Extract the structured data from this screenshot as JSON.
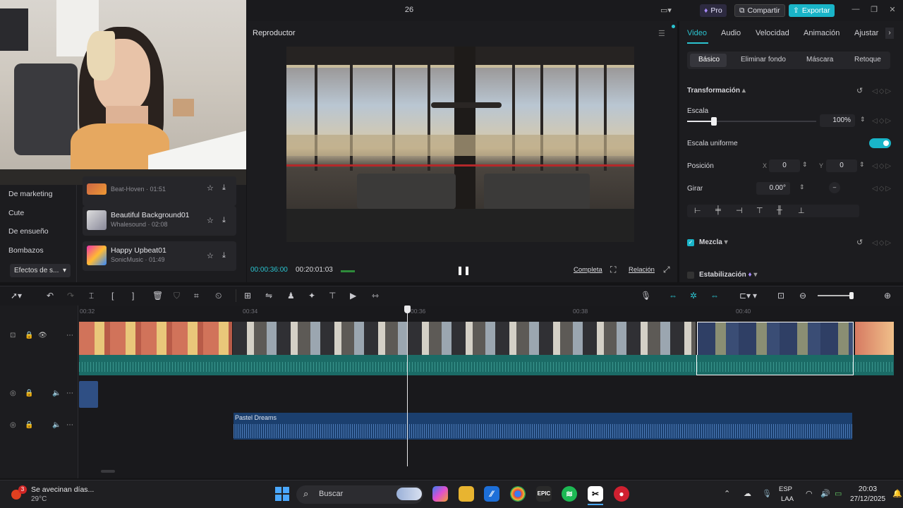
{
  "window": {
    "project_title": "26"
  },
  "header": {
    "pro_label": "Pro",
    "share_label": "Compartir",
    "export_label": "Exportar"
  },
  "sidebar": {
    "categories": [
      "De marketing",
      "Cute",
      "De ensueño",
      "Bombazos"
    ],
    "selected_dropdown": "Efectos de s..."
  },
  "music_list": [
    {
      "name": "",
      "meta": "Beat-Hoven · 01:51"
    },
    {
      "name": "Beautiful Background01",
      "meta": "Whalesound · 02:08"
    },
    {
      "name": "Happy Upbeat01",
      "meta": "SonicMusic · 01:49"
    }
  ],
  "player": {
    "label": "Reproductor",
    "time_current": "00:00:36:00",
    "time_total": "00:20:01:03",
    "full_label": "Completa",
    "ratio_label": "Relación"
  },
  "properties": {
    "tabs": [
      "Video",
      "Audio",
      "Velocidad",
      "Animación",
      "Ajustar"
    ],
    "sub_tabs": [
      "Básico",
      "Eliminar fondo",
      "Máscara",
      "Retoque"
    ],
    "transform_label": "Transformación",
    "scale_label": "Escala",
    "scale_value": "100%",
    "uniform_label": "Escala uniforme",
    "uniform_on": true,
    "position_label": "Posición",
    "pos_x_label": "X",
    "pos_x": "0",
    "pos_y_label": "Y",
    "pos_y": "0",
    "rotate_label": "Girar",
    "rotate_value": "0.00°",
    "blend_label": "Mezcla",
    "stabilize_label": "Estabilización"
  },
  "timeline": {
    "ruler": [
      "00:32",
      "00:34",
      "00:36",
      "00:38",
      "00:40"
    ],
    "music_clip_name": "Pastel Dreams"
  },
  "taskbar": {
    "weather_title": "Se avecinan días...",
    "weather_temp": "29°C",
    "search_label": "Buscar",
    "lang_line1": "ESP",
    "lang_line2": "LAA",
    "time": "20:03",
    "date": "27/12/2025",
    "notification_count": "3"
  },
  "colors": {
    "accent": "#2bc3cf",
    "export": "#19b4c8",
    "video_audio": "#1b6b66",
    "music": "#1b3f6e"
  }
}
